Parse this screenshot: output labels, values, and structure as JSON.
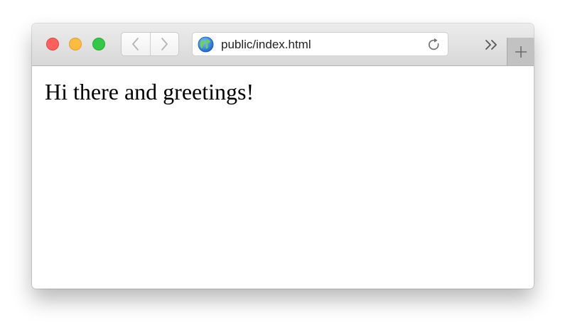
{
  "window": {
    "controls": {
      "close_color": "#fc605c",
      "minimize_color": "#fdbc40",
      "zoom_color": "#34c84a"
    }
  },
  "toolbar": {
    "back_icon": "chevron-left-icon",
    "forward_icon": "chevron-right-icon",
    "address": {
      "site_icon": "globe-icon",
      "url": "public/index.html",
      "reload_icon": "reload-icon"
    },
    "overflow_icon": "double-chevron-right-icon",
    "new_tab_icon": "plus-icon"
  },
  "page": {
    "text": "Hi there and greetings!"
  }
}
